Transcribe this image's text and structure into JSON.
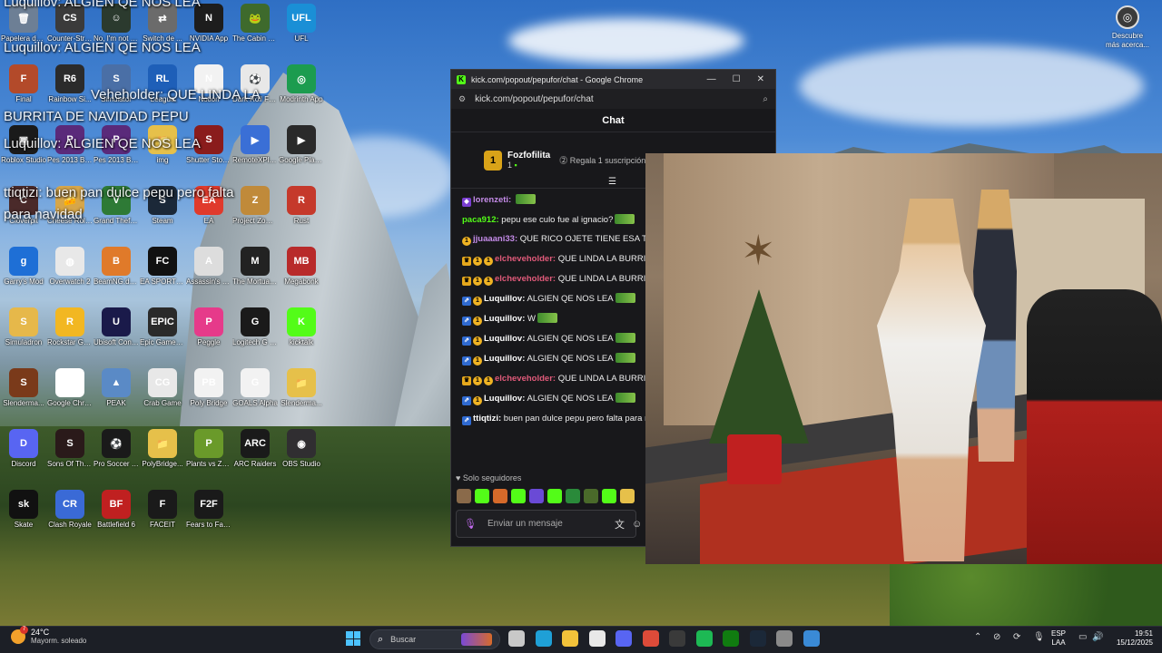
{
  "desktop": {
    "icons": [
      {
        "label": "Papelera de reciclaje",
        "color": "#6d7f95",
        "glyph": "🗑"
      },
      {
        "label": "Counter-Strike 2",
        "color": "#3b3b3b",
        "glyph": "CS"
      },
      {
        "label": "No, I'm not a Human",
        "color": "#2b3a2e",
        "glyph": "☺"
      },
      {
        "label": "Switch de ...",
        "color": "#6b6b6b",
        "glyph": "⇄"
      },
      {
        "label": "NVIDIA App",
        "color": "#1d1d1d",
        "glyph": "N"
      },
      {
        "label": "The Cabin Factory",
        "color": "#3e6a2c",
        "glyph": "🐸"
      },
      {
        "label": "UFL",
        "color": "#1a8fd6",
        "glyph": "UFL"
      },
      {
        "label": "Final",
        "color": "#b34a2a",
        "glyph": "F"
      },
      {
        "label": "Rainbow Si...",
        "color": "#2b2b2b",
        "glyph": "R6"
      },
      {
        "label": "Simulator",
        "color": "#4a6fa6",
        "glyph": "S"
      },
      {
        "label": "League",
        "color": "#1e5fb8",
        "glyph": "RL"
      },
      {
        "label": "Notion",
        "color": "#f2f2f2",
        "glyph": "N"
      },
      {
        "label": "Dark Roll Free Kick Challe...",
        "color": "#e8e8e8",
        "glyph": "⚽"
      },
      {
        "label": "Modrinth App",
        "color": "#1c9c4f",
        "glyph": "◎"
      },
      {
        "label": "Roblox Studio",
        "color": "#1a1a1a",
        "glyph": "▣"
      },
      {
        "label": "Pes 2013 By vintage Ga...",
        "color": "#5a2a7a",
        "glyph": "P"
      },
      {
        "label": "Pes 2013 By vintage Ga...",
        "color": "#5a2a7a",
        "glyph": "P"
      },
      {
        "label": "img",
        "color": "#e6c04a",
        "glyph": "📁"
      },
      {
        "label": "Shutter Story Demo",
        "color": "#8a1c1c",
        "glyph": "S"
      },
      {
        "label": "RemoteXPlayer",
        "color": "#3a6fd6",
        "glyph": "▶"
      },
      {
        "label": "Google Play Juegos",
        "color": "#2a2a2a",
        "glyph": "▶"
      },
      {
        "label": "Cloverpit",
        "color": "#4a2a2a",
        "glyph": "C"
      },
      {
        "label": "Cheese Rolling",
        "color": "#d6a64a",
        "glyph": "🧀"
      },
      {
        "label": "Grand Theft Auto V Enh...",
        "color": "#2e7a36",
        "glyph": "V"
      },
      {
        "label": "Steam",
        "color": "#1b2838",
        "glyph": "S"
      },
      {
        "label": "EA",
        "color": "#e03a2c",
        "glyph": "EA"
      },
      {
        "label": "Project Zomboid",
        "color": "#c08a3a",
        "glyph": "Z"
      },
      {
        "label": "Rust",
        "color": "#c5392b",
        "glyph": "R"
      },
      {
        "label": "Garry's Mod",
        "color": "#1e6fd6",
        "glyph": "g"
      },
      {
        "label": "Overwatch 2",
        "color": "#e8e8e8",
        "glyph": "◍"
      },
      {
        "label": "BeamNG.drive",
        "color": "#e07a2a",
        "glyph": "B"
      },
      {
        "label": "EA SPORTS FC 26",
        "color": "#111111",
        "glyph": "FC"
      },
      {
        "label": "Assassin's Creed I",
        "color": "#dddddd",
        "glyph": "A"
      },
      {
        "label": "The Mortuary Assistant",
        "color": "#222222",
        "glyph": "M"
      },
      {
        "label": "Megabonk",
        "color": "#b82a2a",
        "glyph": "MB"
      },
      {
        "label": "Simuladron",
        "color": "#e6b84a",
        "glyph": "S"
      },
      {
        "label": "Rockstar Games ...",
        "color": "#f2b722",
        "glyph": "R"
      },
      {
        "label": "Ubisoft Connect",
        "color": "#1a1a4a",
        "glyph": "U"
      },
      {
        "label": "Epic Games Launcher",
        "color": "#2a2a2a",
        "glyph": "EPIC"
      },
      {
        "label": "Peggle",
        "color": "#e63a8a",
        "glyph": "P"
      },
      {
        "label": "Logitech G HUB",
        "color": "#1a1a1a",
        "glyph": "G"
      },
      {
        "label": "kicktalk",
        "color": "#53fc18",
        "glyph": "K"
      },
      {
        "label": "Slenderma...",
        "color": "#7a3a1a",
        "glyph": "S"
      },
      {
        "label": "Google Chrome",
        "color": "#ffffff",
        "glyph": "◉"
      },
      {
        "label": "PEAK",
        "color": "#5a8ac6",
        "glyph": "▲"
      },
      {
        "label": "Crab Game",
        "color": "#e8e8e8",
        "glyph": "CG"
      },
      {
        "label": "Poly Bridge",
        "color": "#f2f2f2",
        "glyph": "PB"
      },
      {
        "label": "GOALS Alpha",
        "color": "#f2f2f2",
        "glyph": "G"
      },
      {
        "label": "Slenderma...",
        "color": "#e6c04a",
        "glyph": "📁"
      },
      {
        "label": "Discord",
        "color": "#5865f2",
        "glyph": "D"
      },
      {
        "label": "Sons Of The Forest",
        "color": "#2a1a1a",
        "glyph": "S"
      },
      {
        "label": "Pro Soccer Online",
        "color": "#1a1a1a",
        "glyph": "⚽"
      },
      {
        "label": "PolyBridge...",
        "color": "#e6c04a",
        "glyph": "📁"
      },
      {
        "label": "Plants vs Zombies Tr...",
        "color": "#6a9a2a",
        "glyph": "P"
      },
      {
        "label": "ARC Raiders",
        "color": "#1a1a1a",
        "glyph": "ARC"
      },
      {
        "label": "OBS Studio",
        "color": "#302e31",
        "glyph": "◉"
      },
      {
        "label": "Skate",
        "color": "#111111",
        "glyph": "sk"
      },
      {
        "label": "Clash Royale",
        "color": "#3a6ad6",
        "glyph": "CR"
      },
      {
        "label": "Battlefield 6",
        "color": "#c02020",
        "glyph": "BF"
      },
      {
        "label": "FACEIT",
        "color": "#1a1a1a",
        "glyph": "F"
      },
      {
        "label": "Fears to Fathom...",
        "color": "#1a1a1a",
        "glyph": "F2F"
      }
    ],
    "overlay_lines": [
      "Luquillov: ALGIEN QE NOS LEA",
      "Luquillov: ALGIEN QE NOS LEA",
      "Veheholder: QUE LINDA LA",
      "BURRITA DE NAVIDAD PEPU",
      "Luquillov: ALGIEN QE NOS LEA",
      "ttiqtizi: buen pan dulce pepu pero falta",
      "para navidad"
    ],
    "corner_icon_label": "Descubre más acerca..."
  },
  "chrome": {
    "title": "kick.com/popout/pepufor/chat - Google Chrome",
    "url": "kick.com/popout/pepufor/chat",
    "minimize": "—",
    "maximize": "☐",
    "close": "✕"
  },
  "chat": {
    "header": "Chat",
    "pinned_name": "Fozfofilita",
    "pinned_count": "1",
    "pinned_badge": "1",
    "pinned_gift": "Regala 1 suscripción",
    "messages": [
      {
        "user": "lorenzeti",
        "color": "#c48be8",
        "text": "",
        "badges": [
          "bot"
        ]
      },
      {
        "user": "paca912",
        "color": "#53fc18",
        "text": "pepu ese culo fue al ignacio?",
        "badges": []
      },
      {
        "user": "jjuaaani33",
        "color": "#c48be8",
        "text": "QUE RICO OJETE TIENE ESA TIENE SALUD",
        "badges": [
          "sub"
        ]
      },
      {
        "user": "elcheveholder",
        "color": "#e05a7a",
        "text": "QUE LINDA LA BURRITA",
        "badges": [
          "crown",
          "sub",
          "sub"
        ]
      },
      {
        "user": "elcheveholder",
        "color": "#e05a7a",
        "text": "QUE LINDA LA BURRITA",
        "badges": [
          "crown",
          "sub",
          "sub"
        ]
      },
      {
        "user": "Luquillov",
        "color": "#ffffff",
        "text": "ALGIEN QE NOS LEA",
        "badges": [
          "gift",
          "sub"
        ]
      },
      {
        "user": "Luquillov",
        "color": "#ffffff",
        "text": "W",
        "badges": [
          "gift",
          "sub"
        ]
      },
      {
        "user": "Luquillov",
        "color": "#ffffff",
        "text": "ALGIEN QE NOS LEA",
        "badges": [
          "gift",
          "sub"
        ]
      },
      {
        "user": "Luquillov",
        "color": "#ffffff",
        "text": "ALGIEN QE NOS LEA",
        "badges": [
          "gift",
          "sub"
        ]
      },
      {
        "user": "elcheveholder",
        "color": "#e05a7a",
        "text": "QUE LINDA LA BURRITA",
        "badges": [
          "crown",
          "sub",
          "sub"
        ]
      },
      {
        "user": "Luquillov",
        "color": "#ffffff",
        "text": "ALGIEN QE NOS LEA",
        "badges": [
          "gift",
          "sub"
        ]
      },
      {
        "user": "ttiqtizi",
        "color": "#ffffff",
        "text": "buen pan dulce pepu pero falta para navidad",
        "badges": [
          "gift"
        ]
      }
    ],
    "followers_only": "Solo seguidores",
    "input_placeholder": "Enviar un mensaje"
  },
  "taskbar": {
    "temp": "24°C",
    "weather_desc": "Mayorm. soleado",
    "weather_notif": "7",
    "search_placeholder": "Buscar",
    "lang_1": "ESP",
    "lang_2": "LAA",
    "time": "19:51",
    "date": "15/12/2025",
    "apps": [
      {
        "name": "task-view",
        "color": "#c8c8c8"
      },
      {
        "name": "edge",
        "color": "#1fa0d6"
      },
      {
        "name": "file-explorer",
        "color": "#f2c23a"
      },
      {
        "name": "store",
        "color": "#e8e8e8"
      },
      {
        "name": "discord",
        "color": "#5865f2"
      },
      {
        "name": "chrome",
        "color": "#dd4b39"
      },
      {
        "name": "obs",
        "color": "#3a3a3a"
      },
      {
        "name": "spotify",
        "color": "#1db954"
      },
      {
        "name": "xbox",
        "color": "#107c10"
      },
      {
        "name": "steam",
        "color": "#1b2838"
      },
      {
        "name": "settings",
        "color": "#8a8a8a"
      },
      {
        "name": "remote",
        "color": "#3a8ad6"
      }
    ]
  },
  "colors": {
    "kick_green": "#53fc18",
    "chat_bg": "#18181b"
  }
}
